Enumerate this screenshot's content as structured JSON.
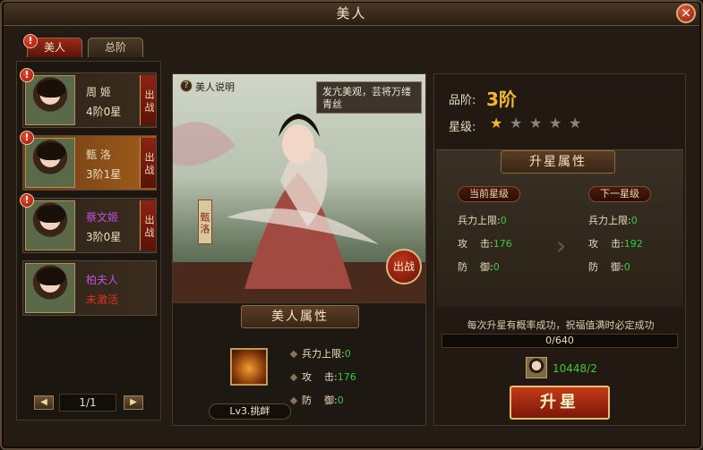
{
  "window": {
    "title": "美人",
    "close_label": "×"
  },
  "tabs": [
    {
      "label": "美人",
      "active": true,
      "alert": "!"
    },
    {
      "label": "总阶",
      "active": false
    }
  ],
  "beauties": [
    {
      "name": "周 姬",
      "status": "4阶0星",
      "alert": "!",
      "button": "出战",
      "name_color": "#e8dcc0",
      "status_color": "#f0e0c0"
    },
    {
      "name": "甄 洛",
      "status": "3阶1星",
      "alert": "!",
      "button": "出战",
      "name_color": "#e8dcc0",
      "status_color": "#f0e0c0"
    },
    {
      "name": "蔡文姬",
      "status": "3阶0星",
      "alert": "!",
      "button": "出战",
      "name_color": "#c050e0",
      "status_color": "#f0e0c0"
    },
    {
      "name": "柏夫人",
      "status": "未激活",
      "name_color": "#c050e0",
      "status_color": "#e03020"
    }
  ],
  "pagination": {
    "prev": "◀",
    "next": "▶",
    "page": "1/1"
  },
  "scene": {
    "help_icon": "?",
    "help_label": "美人说明",
    "tooltip": "发亢美观，芸将万缕青丝",
    "portrait_name": "甄洛",
    "battle_button": "出战"
  },
  "attributes": {
    "title": "美人属性",
    "skill_label": "Lv3.挑衅",
    "rows": [
      {
        "label": "兵力上限:",
        "value": "0"
      },
      {
        "label": "攻    击:",
        "value": "176"
      },
      {
        "label": "防    御:",
        "value": "0"
      }
    ]
  },
  "grade": {
    "label": "品阶:",
    "value": "3阶"
  },
  "stars": {
    "label": "星级:",
    "filled": 1,
    "total": 5,
    "filled_color": "#f0b830",
    "empty_color": "#8a8478"
  },
  "upgrade": {
    "title": "升星属性",
    "current_label": "当前星级",
    "next_label": "下一星级",
    "current": [
      {
        "label": "兵力上限:",
        "value": "0"
      },
      {
        "label": "攻    击:",
        "value": "176"
      },
      {
        "label": "防    御:",
        "value": "0"
      }
    ],
    "next": [
      {
        "label": "兵力上限:",
        "value": "0"
      },
      {
        "label": "攻    击:",
        "value": "192"
      },
      {
        "label": "防    御:",
        "value": "0"
      }
    ],
    "arrow": "›",
    "notice": "每次升星有概率成功，祝福值满时必定成功",
    "blessing": "0/640",
    "blessing_fraction": 0,
    "item_count": "10448/2",
    "button": "升星"
  }
}
